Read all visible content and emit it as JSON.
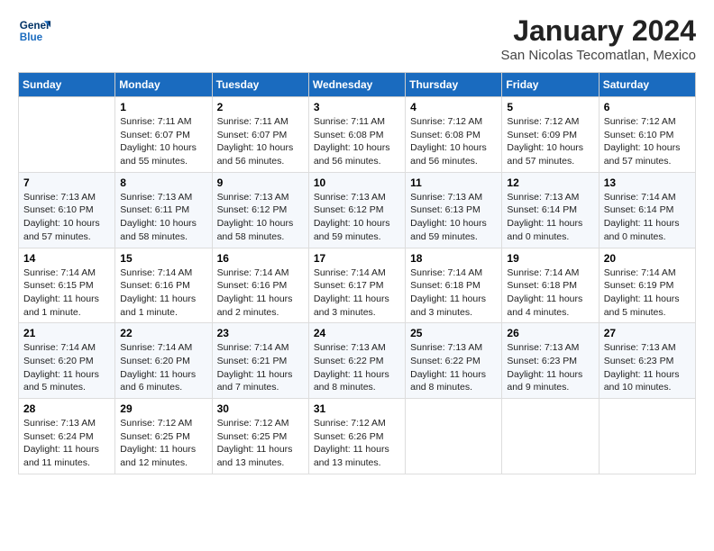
{
  "logo": {
    "line1": "General",
    "line2": "Blue"
  },
  "title": "January 2024",
  "location": "San Nicolas Tecomatlan, Mexico",
  "days_of_week": [
    "Sunday",
    "Monday",
    "Tuesday",
    "Wednesday",
    "Thursday",
    "Friday",
    "Saturday"
  ],
  "weeks": [
    [
      {
        "day": "",
        "info": ""
      },
      {
        "day": "1",
        "info": "Sunrise: 7:11 AM\nSunset: 6:07 PM\nDaylight: 10 hours\nand 55 minutes."
      },
      {
        "day": "2",
        "info": "Sunrise: 7:11 AM\nSunset: 6:07 PM\nDaylight: 10 hours\nand 56 minutes."
      },
      {
        "day": "3",
        "info": "Sunrise: 7:11 AM\nSunset: 6:08 PM\nDaylight: 10 hours\nand 56 minutes."
      },
      {
        "day": "4",
        "info": "Sunrise: 7:12 AM\nSunset: 6:08 PM\nDaylight: 10 hours\nand 56 minutes."
      },
      {
        "day": "5",
        "info": "Sunrise: 7:12 AM\nSunset: 6:09 PM\nDaylight: 10 hours\nand 57 minutes."
      },
      {
        "day": "6",
        "info": "Sunrise: 7:12 AM\nSunset: 6:10 PM\nDaylight: 10 hours\nand 57 minutes."
      }
    ],
    [
      {
        "day": "7",
        "info": "Sunrise: 7:13 AM\nSunset: 6:10 PM\nDaylight: 10 hours\nand 57 minutes."
      },
      {
        "day": "8",
        "info": "Sunrise: 7:13 AM\nSunset: 6:11 PM\nDaylight: 10 hours\nand 58 minutes."
      },
      {
        "day": "9",
        "info": "Sunrise: 7:13 AM\nSunset: 6:12 PM\nDaylight: 10 hours\nand 58 minutes."
      },
      {
        "day": "10",
        "info": "Sunrise: 7:13 AM\nSunset: 6:12 PM\nDaylight: 10 hours\nand 59 minutes."
      },
      {
        "day": "11",
        "info": "Sunrise: 7:13 AM\nSunset: 6:13 PM\nDaylight: 10 hours\nand 59 minutes."
      },
      {
        "day": "12",
        "info": "Sunrise: 7:13 AM\nSunset: 6:14 PM\nDaylight: 11 hours\nand 0 minutes."
      },
      {
        "day": "13",
        "info": "Sunrise: 7:14 AM\nSunset: 6:14 PM\nDaylight: 11 hours\nand 0 minutes."
      }
    ],
    [
      {
        "day": "14",
        "info": "Sunrise: 7:14 AM\nSunset: 6:15 PM\nDaylight: 11 hours\nand 1 minute."
      },
      {
        "day": "15",
        "info": "Sunrise: 7:14 AM\nSunset: 6:16 PM\nDaylight: 11 hours\nand 1 minute."
      },
      {
        "day": "16",
        "info": "Sunrise: 7:14 AM\nSunset: 6:16 PM\nDaylight: 11 hours\nand 2 minutes."
      },
      {
        "day": "17",
        "info": "Sunrise: 7:14 AM\nSunset: 6:17 PM\nDaylight: 11 hours\nand 3 minutes."
      },
      {
        "day": "18",
        "info": "Sunrise: 7:14 AM\nSunset: 6:18 PM\nDaylight: 11 hours\nand 3 minutes."
      },
      {
        "day": "19",
        "info": "Sunrise: 7:14 AM\nSunset: 6:18 PM\nDaylight: 11 hours\nand 4 minutes."
      },
      {
        "day": "20",
        "info": "Sunrise: 7:14 AM\nSunset: 6:19 PM\nDaylight: 11 hours\nand 5 minutes."
      }
    ],
    [
      {
        "day": "21",
        "info": "Sunrise: 7:14 AM\nSunset: 6:20 PM\nDaylight: 11 hours\nand 5 minutes."
      },
      {
        "day": "22",
        "info": "Sunrise: 7:14 AM\nSunset: 6:20 PM\nDaylight: 11 hours\nand 6 minutes."
      },
      {
        "day": "23",
        "info": "Sunrise: 7:14 AM\nSunset: 6:21 PM\nDaylight: 11 hours\nand 7 minutes."
      },
      {
        "day": "24",
        "info": "Sunrise: 7:13 AM\nSunset: 6:22 PM\nDaylight: 11 hours\nand 8 minutes."
      },
      {
        "day": "25",
        "info": "Sunrise: 7:13 AM\nSunset: 6:22 PM\nDaylight: 11 hours\nand 8 minutes."
      },
      {
        "day": "26",
        "info": "Sunrise: 7:13 AM\nSunset: 6:23 PM\nDaylight: 11 hours\nand 9 minutes."
      },
      {
        "day": "27",
        "info": "Sunrise: 7:13 AM\nSunset: 6:23 PM\nDaylight: 11 hours\nand 10 minutes."
      }
    ],
    [
      {
        "day": "28",
        "info": "Sunrise: 7:13 AM\nSunset: 6:24 PM\nDaylight: 11 hours\nand 11 minutes."
      },
      {
        "day": "29",
        "info": "Sunrise: 7:12 AM\nSunset: 6:25 PM\nDaylight: 11 hours\nand 12 minutes."
      },
      {
        "day": "30",
        "info": "Sunrise: 7:12 AM\nSunset: 6:25 PM\nDaylight: 11 hours\nand 13 minutes."
      },
      {
        "day": "31",
        "info": "Sunrise: 7:12 AM\nSunset: 6:26 PM\nDaylight: 11 hours\nand 13 minutes."
      },
      {
        "day": "",
        "info": ""
      },
      {
        "day": "",
        "info": ""
      },
      {
        "day": "",
        "info": ""
      }
    ]
  ]
}
